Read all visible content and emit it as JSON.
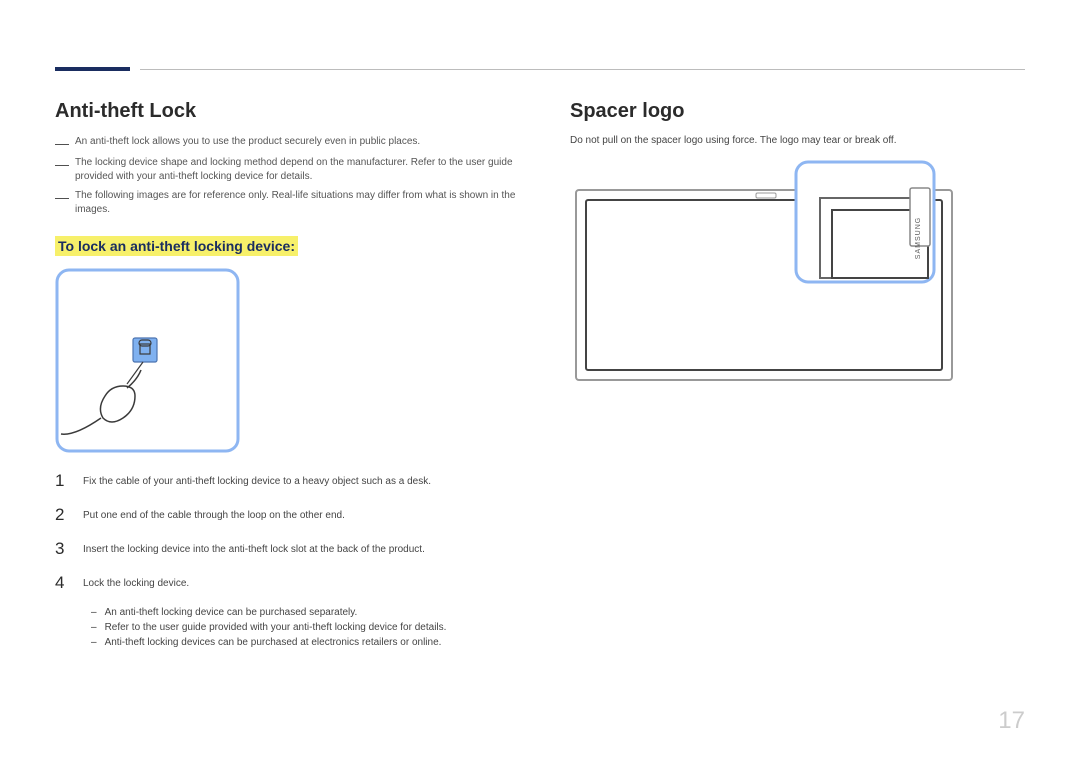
{
  "page_number": "17",
  "left": {
    "heading": "Anti-theft Lock",
    "notes": [
      "An anti-theft lock allows you to use the product securely even in public places.",
      "The locking device shape and locking method depend on the manufacturer. Refer to the user guide provided with your anti-theft locking device for details.",
      "The following images are for reference only. Real-life situations may differ from what is shown in the images."
    ],
    "sub_heading": "To lock an anti-theft locking device:",
    "steps": [
      "Fix the cable of your anti-theft locking device to a heavy object such as a desk.",
      "Put one end of the cable through the loop on the other end.",
      "Insert the locking device into the anti-theft lock slot at the back of the product.",
      "Lock the locking device."
    ],
    "sub_bullets": [
      "An anti-theft locking device can be purchased separately.",
      "Refer to the user guide provided with your anti-theft locking device for details.",
      "Anti-theft locking devices can be purchased at electronics retailers or online."
    ]
  },
  "right": {
    "heading": "Spacer logo",
    "note": "Do not pull on the spacer logo using force. The logo may tear or break off.",
    "brand_text": "SAMSUNG"
  }
}
